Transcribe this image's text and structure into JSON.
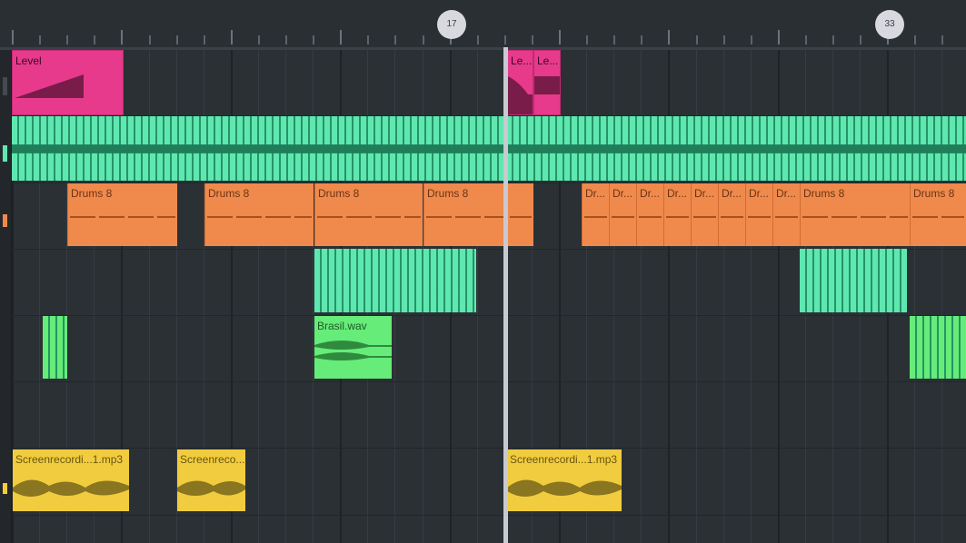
{
  "ruler": {
    "markers": [
      "17",
      "33"
    ]
  },
  "colors": {
    "automation": "#e73a8c",
    "audio_teal": "#5fe7b0",
    "pattern_orange": "#ef8a4c",
    "audio_green": "#66ec79",
    "audio_yellow": "#f0cc3e",
    "playhead": "#c8cad1"
  },
  "tracks": [
    {
      "clips": [
        {
          "label": "Level"
        },
        {
          "label": "Le..."
        },
        {
          "label": "Le..."
        }
      ]
    },
    {
      "clips": [
        {
          "label": ""
        }
      ]
    },
    {
      "clips": [
        {
          "label": "Drums 8"
        },
        {
          "label": "Drums 8"
        },
        {
          "label": "Drums 8"
        },
        {
          "label": "Drums 8"
        },
        {
          "label": ""
        },
        {
          "label": "Dr..."
        },
        {
          "label": "Dr..."
        },
        {
          "label": "Dr..."
        },
        {
          "label": "Dr..."
        },
        {
          "label": "Dr..."
        },
        {
          "label": "Dr..."
        },
        {
          "label": "Dr..."
        },
        {
          "label": "Dr..."
        },
        {
          "label": "Drums 8"
        },
        {
          "label": "Drums 8"
        }
      ]
    },
    {
      "clips": [
        {
          "label": ""
        },
        {
          "label": ""
        }
      ]
    },
    {
      "clips": [
        {
          "label": ""
        },
        {
          "label": "Brasil.wav"
        },
        {
          "label": ""
        }
      ]
    },
    {
      "clips": []
    },
    {
      "clips": [
        {
          "label": "Screenrecordi...1.mp3"
        },
        {
          "label": "Screenreco..."
        },
        {
          "label": "Screenrecordi...1.mp3"
        }
      ]
    }
  ]
}
